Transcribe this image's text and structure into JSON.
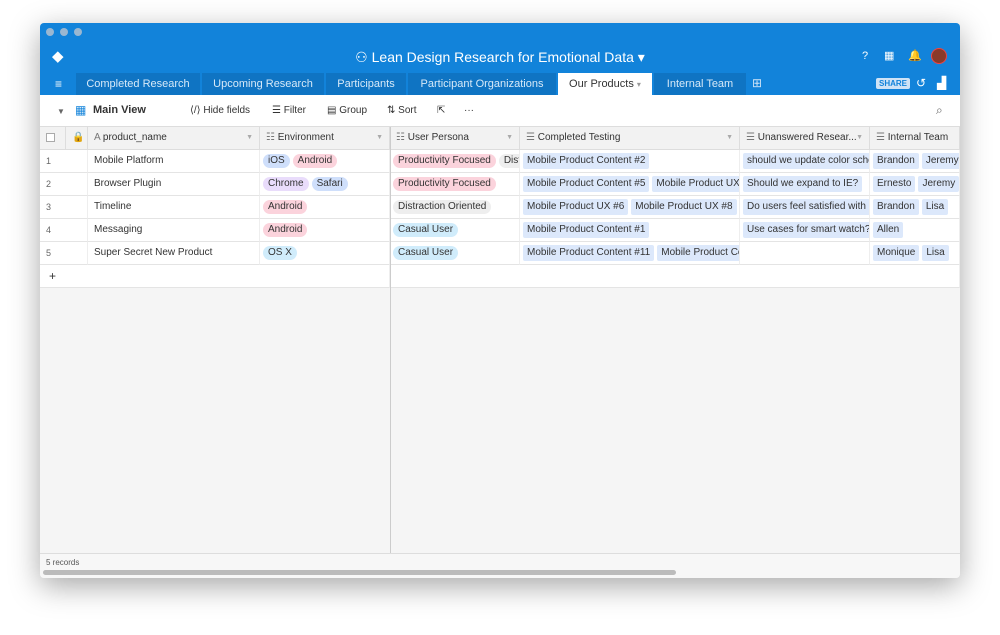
{
  "app": {
    "title": "Lean Design Research for Emotional Data"
  },
  "tabs": [
    {
      "label": "Completed Research"
    },
    {
      "label": "Upcoming Research"
    },
    {
      "label": "Participants"
    },
    {
      "label": "Participant Organizations"
    },
    {
      "label": "Our Products",
      "active": true
    },
    {
      "label": "Internal Team"
    }
  ],
  "share_label": "SHARE",
  "toolbar": {
    "view": "Main View",
    "hide_fields": "Hide fields",
    "filter": "Filter",
    "group": "Group",
    "sort": "Sort",
    "more": "···"
  },
  "columns": [
    "product_name",
    "Environment",
    "User Persona",
    "Completed Testing",
    "Unanswered Resear...",
    "Internal Team"
  ],
  "rows": [
    {
      "n": "1",
      "name": "Mobile Platform",
      "env": [
        [
          "iOS",
          "#cfdffb"
        ],
        [
          "Android",
          "#fbd3dc"
        ]
      ],
      "persona": [
        [
          "Productivity Focused",
          "#fbd3dc"
        ],
        [
          "Distraction Oriented",
          "#eee"
        ]
      ],
      "testing": [
        "Mobile Product Content #2"
      ],
      "question": "should we update color scheme?",
      "team": [
        "Brandon",
        "Jeremy"
      ]
    },
    {
      "n": "2",
      "name": "Browser Plugin",
      "env": [
        [
          "Chrome",
          "#e9dcfb"
        ],
        [
          "Safari",
          "#cfdffb"
        ]
      ],
      "persona": [
        [
          "Productivity Focused",
          "#fbd3dc"
        ]
      ],
      "testing": [
        "Mobile Product Content #5",
        "Mobile Product UX"
      ],
      "question": "Should we expand to IE?",
      "team": [
        "Ernesto",
        "Jeremy"
      ]
    },
    {
      "n": "3",
      "name": "Timeline",
      "env": [
        [
          "Android",
          "#fbd3dc"
        ]
      ],
      "persona": [
        [
          "Distraction Oriented",
          "#eee"
        ]
      ],
      "testing": [
        "Mobile Product UX #6",
        "Mobile Product UX #8"
      ],
      "question": "Do users feel satisfied with",
      "team": [
        "Brandon",
        "Lisa"
      ]
    },
    {
      "n": "4",
      "name": "Messaging",
      "env": [
        [
          "Android",
          "#fbd3dc"
        ]
      ],
      "persona": [
        [
          "Casual User",
          "#d0ecfb"
        ]
      ],
      "testing": [
        "Mobile Product Content #1"
      ],
      "question": "Use cases for smart watch?",
      "team": [
        "Allen"
      ]
    },
    {
      "n": "5",
      "name": "Super Secret New Product",
      "env": [
        [
          "OS X",
          "#d0ecfb"
        ]
      ],
      "persona": [
        [
          "Casual User",
          "#d0ecfb"
        ]
      ],
      "testing": [
        "Mobile Product Content #11",
        "Mobile Product Co"
      ],
      "question": "",
      "team": [
        "Monique",
        "Lisa"
      ]
    }
  ],
  "footer": {
    "records": "5 records"
  },
  "colors": {
    "brand": "#1283da",
    "tab_bg": "#0f74c3"
  }
}
